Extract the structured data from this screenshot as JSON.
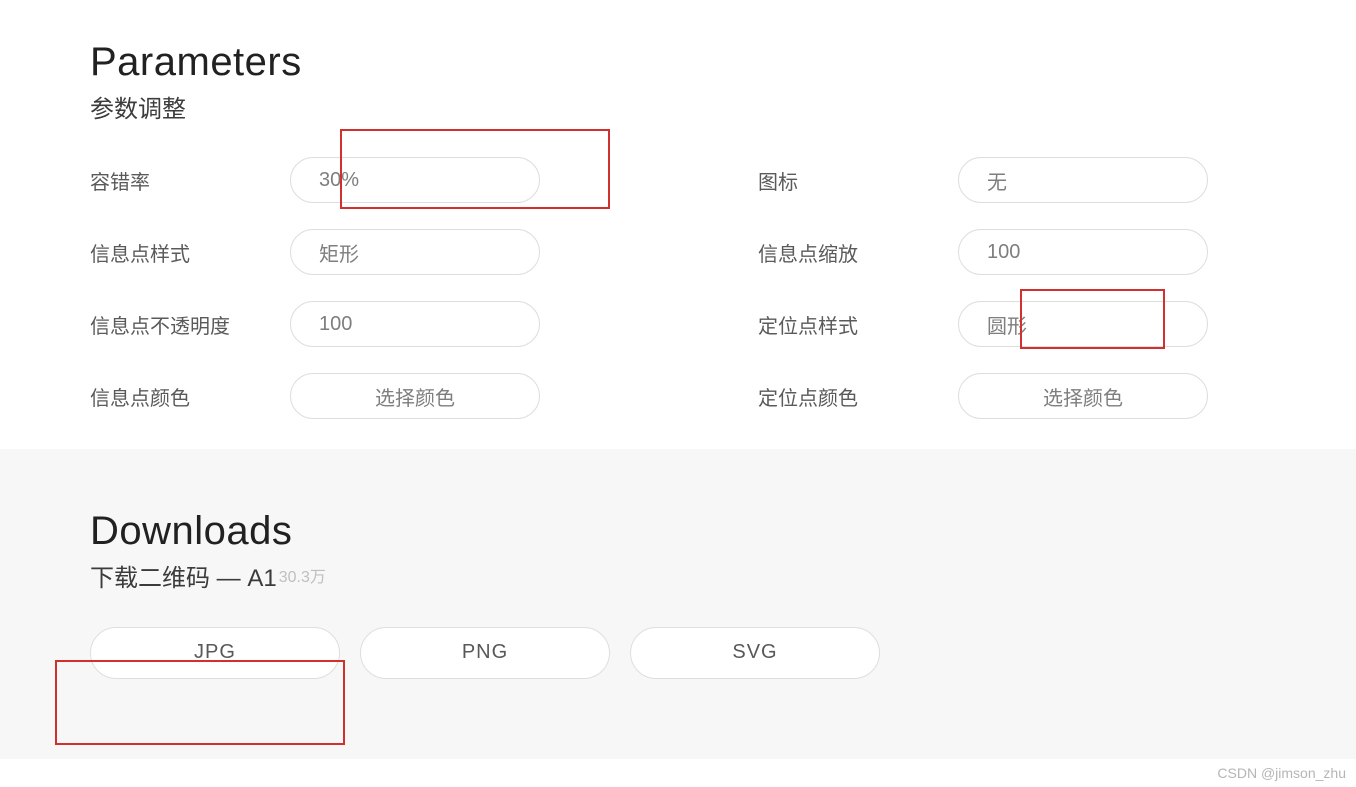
{
  "parameters": {
    "title": "Parameters",
    "subtitle": "参数调整",
    "rows": {
      "error": {
        "label": "容错率",
        "value": "30%"
      },
      "icon": {
        "label": "图标",
        "value": "无"
      },
      "ptstyle": {
        "label": "信息点样式",
        "value": "矩形"
      },
      "ptscale": {
        "label": "信息点缩放",
        "value": "100"
      },
      "ptopacity": {
        "label": "信息点不透明度",
        "value": "100"
      },
      "anchorstyle": {
        "label": "定位点样式",
        "value": "圆形"
      },
      "ptcolor": {
        "label": "信息点颜色",
        "value": "选择颜色"
      },
      "anchorcolor": {
        "label": "定位点颜色",
        "value": "选择颜色"
      }
    }
  },
  "downloads": {
    "title": "Downloads",
    "subtitle_prefix": "下载二维码 — A1",
    "subtitle_sup": "30.3万",
    "buttons": {
      "jpg": "JPG",
      "png": "PNG",
      "svg": "SVG"
    }
  },
  "watermark": "CSDN @jimson_zhu"
}
